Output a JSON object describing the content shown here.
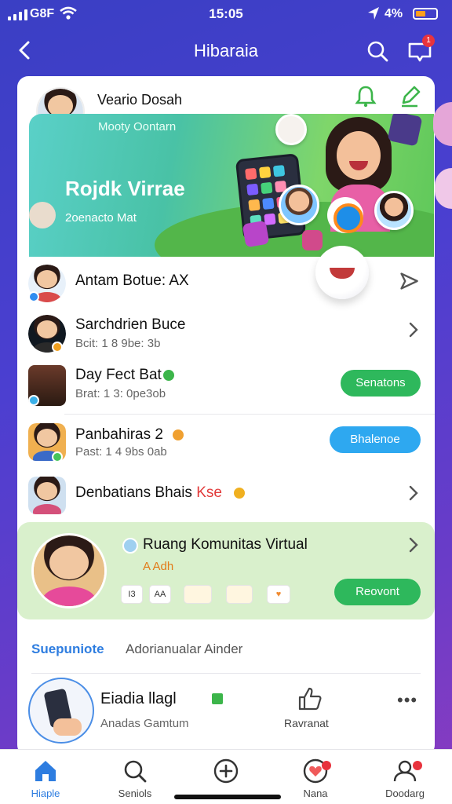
{
  "status": {
    "carrier": "G8F",
    "time": "15:05",
    "battery_pct": "4%"
  },
  "nav": {
    "title": "Hibaraia",
    "inbox_badge": "1"
  },
  "profile": {
    "name": "Veario Dosah"
  },
  "banner": {
    "subtitle": "Mooty Oontarn",
    "title": "Rojdk Virrae",
    "meta": "2oenacto Mat"
  },
  "rows": [
    {
      "title": "Antam Botue: AX",
      "subtitle": ""
    },
    {
      "title": "Sarchdrien Buce",
      "subtitle": "Bcit: 1 8 9be: 3b"
    },
    {
      "title": "Day Fect Bat",
      "subtitle": "Brat: 1 3: 0pe3ob",
      "action": "Senatons"
    },
    {
      "title": "Panbahiras 2",
      "subtitle": "Past: 1 4 9bs 0ab",
      "action": "Bhalenoe"
    },
    {
      "title": "Denbatians Bhais",
      "title_accent": "Kse",
      "subtitle": ""
    }
  ],
  "community": {
    "title": "Ruang Komunitas Virtual",
    "subtitle": "A Adh",
    "chips": [
      "I3",
      "AA",
      "",
      "",
      ""
    ],
    "action": "Reovont"
  },
  "tabs": {
    "active": "Suepuniote",
    "other": "Adorianualar Ainder"
  },
  "post": {
    "title": "Eiadia llagl",
    "subtitle": "Anadas Gamtum",
    "like_label": "Ravranat"
  },
  "bottom_nav": [
    {
      "label": "Hiaple",
      "icon": "home-icon"
    },
    {
      "label": "Seniols",
      "icon": "search-icon"
    },
    {
      "label": "",
      "icon": "add-icon"
    },
    {
      "label": "Nana",
      "icon": "heart-icon"
    },
    {
      "label": "Doodarg",
      "icon": "profile-icon"
    }
  ],
  "colors": {
    "accent": "#2e7de0",
    "green": "#2eb85c",
    "blue": "#2ea8f0",
    "community_bg": "#d9f0cc"
  }
}
